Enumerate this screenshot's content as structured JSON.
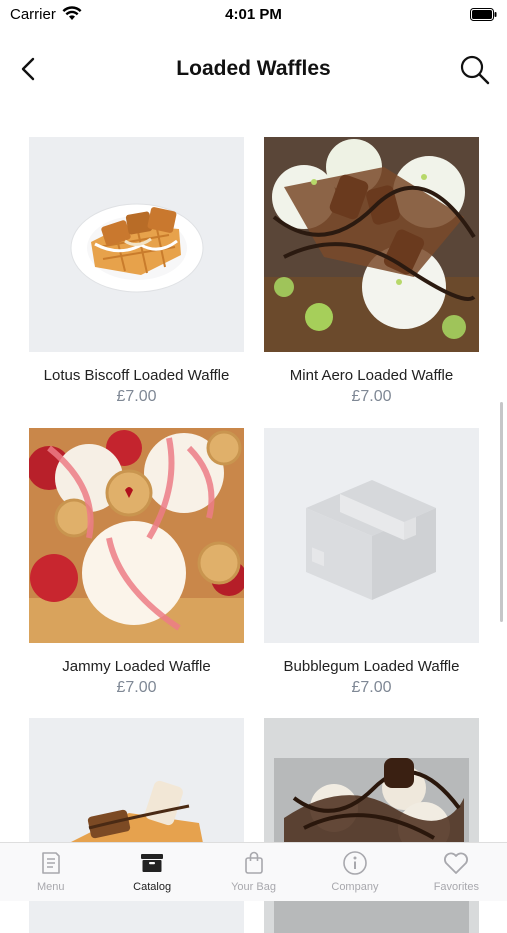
{
  "status": {
    "carrier": "Carrier",
    "time": "4:01 PM"
  },
  "header": {
    "title": "Loaded Waffles"
  },
  "products": [
    {
      "name": "Lotus Biscoff Loaded Waffle",
      "price": "£7.00"
    },
    {
      "name": "Mint Aero Loaded Waffle",
      "price": "£7.00"
    },
    {
      "name": "Jammy Loaded Waffle",
      "price": "£7.00"
    },
    {
      "name": "Bubblegum Loaded Waffle",
      "price": "£7.00"
    }
  ],
  "tabs": [
    {
      "label": "Menu",
      "icon": "menu-book-icon"
    },
    {
      "label": "Catalog",
      "icon": "catalog-box-icon"
    },
    {
      "label": "Your Bag",
      "icon": "shopping-bag-icon"
    },
    {
      "label": "Company",
      "icon": "info-icon"
    },
    {
      "label": "Favorites",
      "icon": "heart-icon"
    }
  ],
  "active_tab": "Catalog"
}
